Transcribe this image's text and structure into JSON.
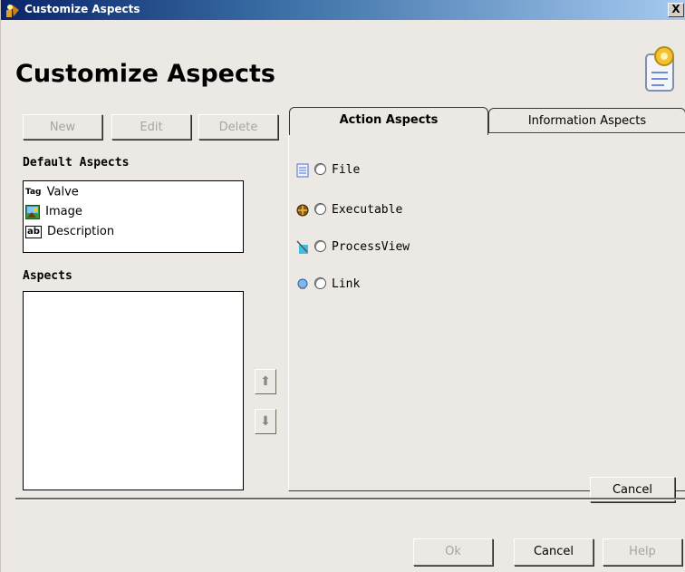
{
  "window": {
    "title": "Customize Aspects",
    "close_glyph": "X"
  },
  "header": {
    "heading": "Customize Aspects"
  },
  "toolbar": {
    "new_label": "New",
    "edit_label": "Edit",
    "delete_label": "Delete"
  },
  "default_aspects": {
    "label": "Default Aspects",
    "items": [
      {
        "icon": "tag-icon",
        "icon_text": "Tag",
        "label": "Valve"
      },
      {
        "icon": "image-icon",
        "label": "Image"
      },
      {
        "icon": "text-field-icon",
        "icon_text": "ab",
        "label": "Description"
      }
    ]
  },
  "aspects": {
    "label": "Aspects",
    "items": []
  },
  "tabs": [
    {
      "label": "Action Aspects",
      "active": true
    },
    {
      "label": "Information Aspects",
      "active": false
    }
  ],
  "action_aspects": [
    {
      "icon": "document-icon",
      "label": "File"
    },
    {
      "icon": "executable-icon",
      "label": "Executable"
    },
    {
      "icon": "process-view-icon",
      "label": "ProcessView"
    },
    {
      "icon": "globe-link-icon",
      "label": "Link"
    }
  ],
  "panel": {
    "cancel_label": "Cancel"
  },
  "footer": {
    "ok_label": "Ok",
    "cancel_label": "Cancel",
    "help_label": "Help"
  },
  "colors": {
    "window_bg": "#ece9e5",
    "title_gradient_start": "#0a246a",
    "title_gradient_end": "#a6caf0",
    "disabled_text": "#a8a59c"
  }
}
